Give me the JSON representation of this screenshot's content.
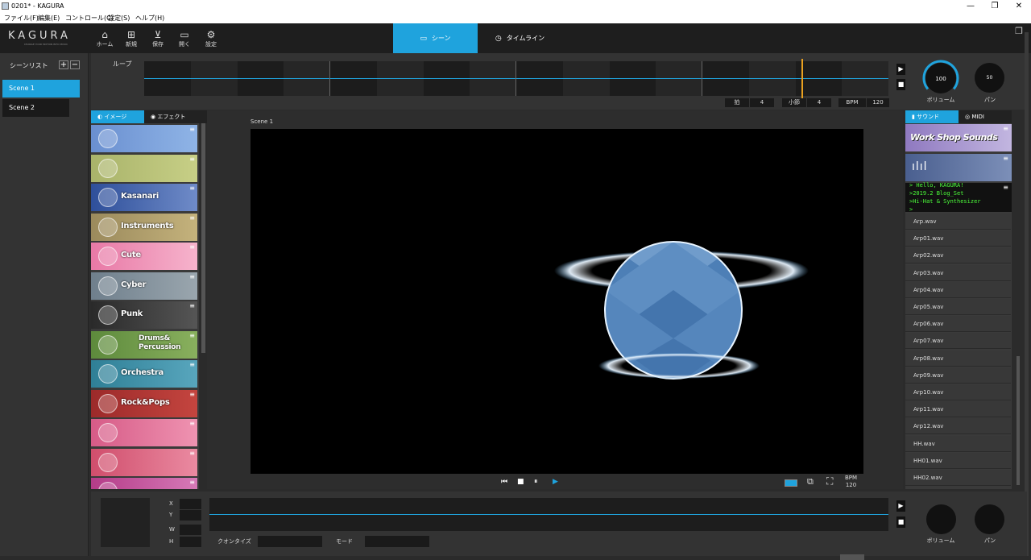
{
  "window": {
    "title": "0201* - KAGURA",
    "controls": {
      "minimize": "—",
      "maximize": "❐",
      "close": "✕"
    }
  },
  "menu": [
    "ファイル(F)",
    "編集(E)",
    "コントロール(C)",
    "設定(S)",
    "ヘルプ(H)"
  ],
  "toolbar": {
    "logo": "KAGURA",
    "logo_sub": "CHANGE YOUR MOTION INTO MUSIC",
    "buttons": [
      {
        "label": "ホーム",
        "icon": "home-icon"
      },
      {
        "label": "新規",
        "icon": "new-icon"
      },
      {
        "label": "保存",
        "icon": "save-icon"
      },
      {
        "label": "開く",
        "icon": "open-folder-icon"
      },
      {
        "label": "設定",
        "icon": "gear-icon"
      }
    ],
    "tabs": [
      {
        "label": "シーン",
        "active": true,
        "icon": "monitor-icon"
      },
      {
        "label": "タイムライン",
        "active": false,
        "icon": "clock-icon"
      }
    ]
  },
  "scene_list": {
    "title": "シーンリスト",
    "add": "+",
    "remove": "−",
    "scenes": [
      {
        "label": "Scene  1",
        "active": true
      },
      {
        "label": "Scene  2",
        "active": false
      }
    ]
  },
  "loop": {
    "label": "ループ",
    "beat_label": "拍",
    "beat_value": "4",
    "measure_label": "小節",
    "measure_value": "4",
    "bpm_label": "BPM",
    "bpm_value": "120",
    "play": "▶",
    "stop": "■"
  },
  "volume": {
    "value": "100",
    "label": "ボリューム",
    "level_percent": 100
  },
  "pan": {
    "value": "50",
    "label": "パン"
  },
  "asset_tabs": [
    {
      "label": "イメージ",
      "active": true
    },
    {
      "label": "エフェクト",
      "active": false
    }
  ],
  "asset_cards": [
    {
      "label": "",
      "colors": [
        "#6a8fd0",
        "#8fb4e6"
      ]
    },
    {
      "label": "",
      "colors": [
        "#a9b36a",
        "#c7cf86"
      ]
    },
    {
      "label": "Kasanari",
      "colors": [
        "#2e4f9a",
        "#6f8bc8"
      ]
    },
    {
      "label": "Instruments",
      "colors": [
        "#9b8a5c",
        "#c4b27c"
      ]
    },
    {
      "label": "Cute",
      "colors": [
        "#e879a6",
        "#f6b3cc"
      ]
    },
    {
      "label": "Cyber",
      "colors": [
        "#6f7f8c",
        "#9aa6ae"
      ]
    },
    {
      "label": "Punk",
      "colors": [
        "#2a2a2a",
        "#555555"
      ]
    },
    {
      "label": "Drums&\nPercussion",
      "colors": [
        "#5d8a3c",
        "#89b05e"
      ]
    },
    {
      "label": "Orchestra",
      "colors": [
        "#2f7f96",
        "#58a6bd"
      ]
    },
    {
      "label": "Rock&Pops",
      "colors": [
        "#9c2a2a",
        "#c4453f"
      ]
    },
    {
      "label": "",
      "colors": [
        "#d65b87",
        "#ef93b1"
      ]
    },
    {
      "label": "",
      "colors": [
        "#d04e6c",
        "#ea8aa1"
      ]
    },
    {
      "label": "",
      "colors": [
        "#b43c88",
        "#d679b7"
      ]
    }
  ],
  "preview": {
    "scene_label": "Scene  1",
    "bpm_label": "BPM",
    "bpm_value": "120",
    "controls": {
      "prev": "⏮",
      "stop": "■",
      "pause": "⏸",
      "play": "▶"
    }
  },
  "sound_tabs": [
    {
      "label": "サウンド",
      "active": true
    },
    {
      "label": "MIDI",
      "active": false
    }
  ],
  "sound_cards": {
    "workshop": "Work Shop Sounds",
    "console_lines": [
      "> Hello, KAGURA!",
      ">2019.2 Blog_Set",
      ">Hi-Hat & Synthesizer",
      ">"
    ]
  },
  "sound_files": [
    "Arp.wav",
    "Arp01.wav",
    "Arp02.wav",
    "Arp03.wav",
    "Arp04.wav",
    "Arp05.wav",
    "Arp06.wav",
    "Arp07.wav",
    "Arp08.wav",
    "Arp09.wav",
    "Arp10.wav",
    "Arp11.wav",
    "Arp12.wav",
    "HH.wav",
    "HH01.wav",
    "HH02.wav"
  ],
  "bottom": {
    "coords": [
      "X",
      "Y",
      "W",
      "H"
    ],
    "quantize_label": "クオンタイズ",
    "mode_label": "モード",
    "volume_label": "ボリューム",
    "pan_label": "パン",
    "play": "▶",
    "stop": "■"
  },
  "colors": {
    "accent": "#1fa3dd",
    "marker": "#e8a020",
    "console_text": "#4cff3a"
  }
}
